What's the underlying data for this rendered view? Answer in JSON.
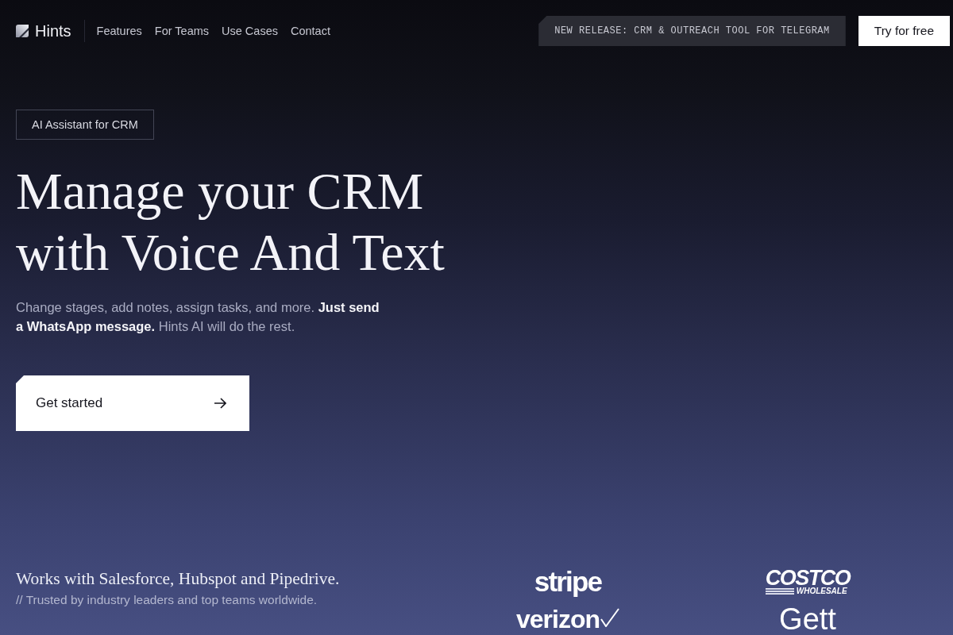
{
  "nav": {
    "brand": "Hints",
    "links": [
      "Features",
      "For Teams",
      "Use Cases",
      "Contact"
    ],
    "announcement": "NEW RELEASE: CRM & OUTREACH TOOL FOR TELEGRAM",
    "cta": "Try for free"
  },
  "hero": {
    "badge": "AI Assistant for CRM",
    "headline": "Manage your CRM with Voice And Text",
    "subtitle": "Change stages, add notes, assign tasks, and more. **Just send a WhatsApp message.** Hints AI will do the rest.",
    "button": "Get started"
  },
  "integrations": {
    "title": "Works with Salesforce, Hubspot and Pipedrive.",
    "subtitle": "// Trusted by industry leaders and top teams worldwide.",
    "logos": [
      {
        "kind": "stripe",
        "text": "stripe"
      },
      {
        "kind": "costco",
        "text": "COSTCO",
        "subtext": "WHOLESALE"
      },
      {
        "kind": "verizon",
        "text": "verizon"
      },
      {
        "kind": "gett",
        "text": "Gett"
      }
    ]
  }
}
